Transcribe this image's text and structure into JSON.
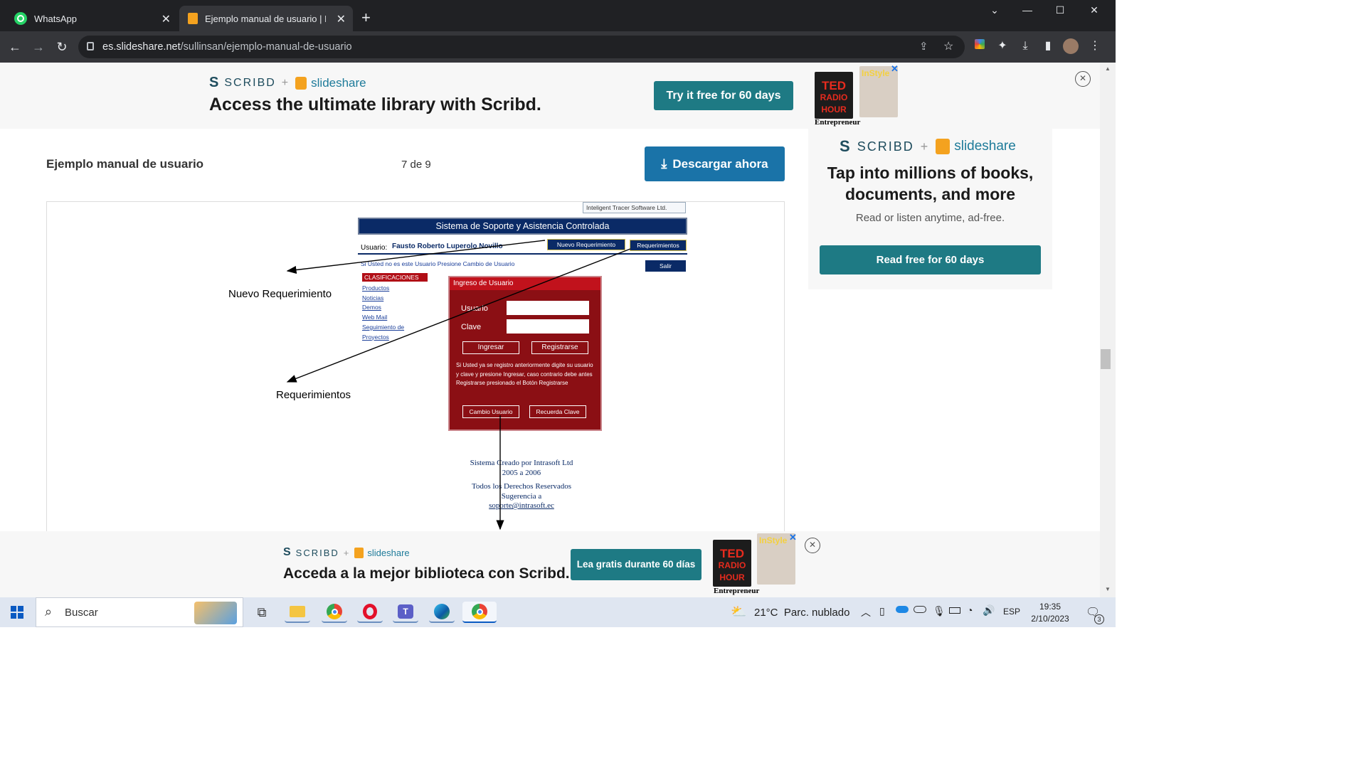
{
  "browser": {
    "tabs": [
      {
        "label": "WhatsApp",
        "icon": "whatsapp-icon"
      },
      {
        "label": "Ejemplo manual de usuario | PDF",
        "icon": "slideshare-icon"
      }
    ],
    "url_host": "es.slideshare.net",
    "url_path": "/sullinsan/ejemplo-manual-de-usuario"
  },
  "top_ad": {
    "brand_scribd": "SCRIBD",
    "plus": "+",
    "brand_slideshare": "slideshare",
    "headline": "Access the ultimate library with Scribd.",
    "cta": "Try it free for 60 days"
  },
  "side_ad": {
    "brand_scribd": "SCRIBD",
    "plus": "+",
    "brand_slideshare": "slideshare",
    "headline": "Tap into millions of books, documents, and more",
    "subtext": "Read or listen anytime, ad-free.",
    "cta": "Read free for 60 days"
  },
  "doc": {
    "title": "Ejemplo manual de usuario",
    "page_indicator": "7 de 9",
    "download": "Descargar ahora"
  },
  "slide": {
    "company_banner": "Inteligent Tracer Software Ltd.",
    "system_title": "Sistema de Soporte y Asistencia Controlada",
    "user_label": "Usuario:",
    "user_name": "Fausto Roberto Luperolo Novillo",
    "btn_new_req": "Nuevo Requerimiento",
    "btn_reqs": "Requerimientos",
    "change_user_notice": "Si Usted no es este Usuario Presione Cambio de Usuario",
    "btn_exit": "Salir",
    "classif_header": "CLASIFICACIONES",
    "links": [
      "Productos",
      "Noticias",
      "Demos",
      "Web Mail",
      "Seguimiento de",
      "Proyectos"
    ],
    "login_header": "Ingreso de Usuario",
    "field_user": "Usuario",
    "field_pass": "Clave",
    "btn_login": "Ingresar",
    "btn_register": "Registrarse",
    "login_help": "Si Usted ya se registro anteriormente digite su usuario y clave y presione Ingresar, caso contrario debe antes Registrarse presionado el Botón Registrarse",
    "btn_change_user": "Cambio Usuario",
    "btn_remember": "Recuerda Clave",
    "footer1": "Sistema Creado por Intrasoft Ltd",
    "footer2": "2005 a 2006",
    "footer3": "Todos los Derechos Reservados",
    "footer4": "Sugerencia a",
    "footer5": "soporte@intrasoft.ec",
    "annot_new": "Nuevo Requerimiento",
    "annot_reqs": "Requerimientos"
  },
  "bottom_ad": {
    "brand_scribd": "SCRIBD",
    "plus": "+",
    "brand_slideshare": "slideshare",
    "headline": "Acceda a la mejor biblioteca con Scribd.",
    "cta": "Lea gratis durante 60 días"
  },
  "covers": {
    "ted_line1": "TED",
    "ted_line2": "RADIO",
    "ted_line3": "HOUR",
    "entrepreneur": "Entrepreneur",
    "instyle": "InStyle"
  },
  "taskbar": {
    "search_label": "Buscar",
    "weather": "21°C  Parc. nublado",
    "lang": "ESP",
    "time": "19:35",
    "date": "2/10/2023",
    "notif_count": "3"
  },
  "colors": {
    "teal": "#1e7a84",
    "download_blue": "#1a73a8",
    "login_red": "#8b0f14",
    "navy": "#0a2a66"
  }
}
